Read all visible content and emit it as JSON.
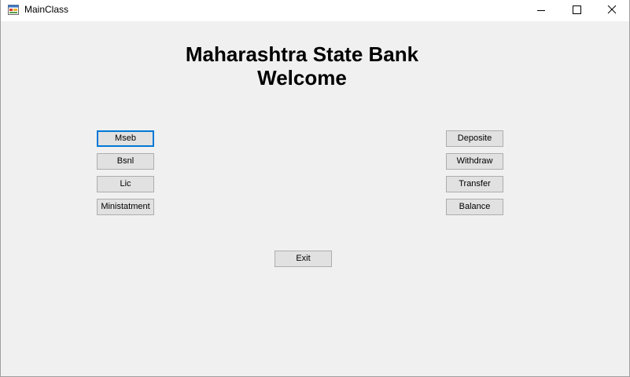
{
  "window": {
    "title": "MainClass"
  },
  "heading": {
    "line1": "Maharashtra State Bank",
    "line2": "Welcome"
  },
  "left_buttons": [
    {
      "label": "Mseb"
    },
    {
      "label": "Bsnl"
    },
    {
      "label": "Lic"
    },
    {
      "label": "Ministatment"
    }
  ],
  "right_buttons": [
    {
      "label": "Deposite"
    },
    {
      "label": "Withdraw"
    },
    {
      "label": "Transfer"
    },
    {
      "label": "Balance"
    }
  ],
  "exit_button": {
    "label": "Exit"
  },
  "icons": {
    "app": "app-form-icon",
    "minimize": "minimize-icon",
    "maximize": "maximize-icon",
    "close": "close-icon"
  },
  "colors": {
    "form_background": "#f0f0f0",
    "button_face": "#e1e1e1",
    "focus_border": "#0078d7"
  }
}
